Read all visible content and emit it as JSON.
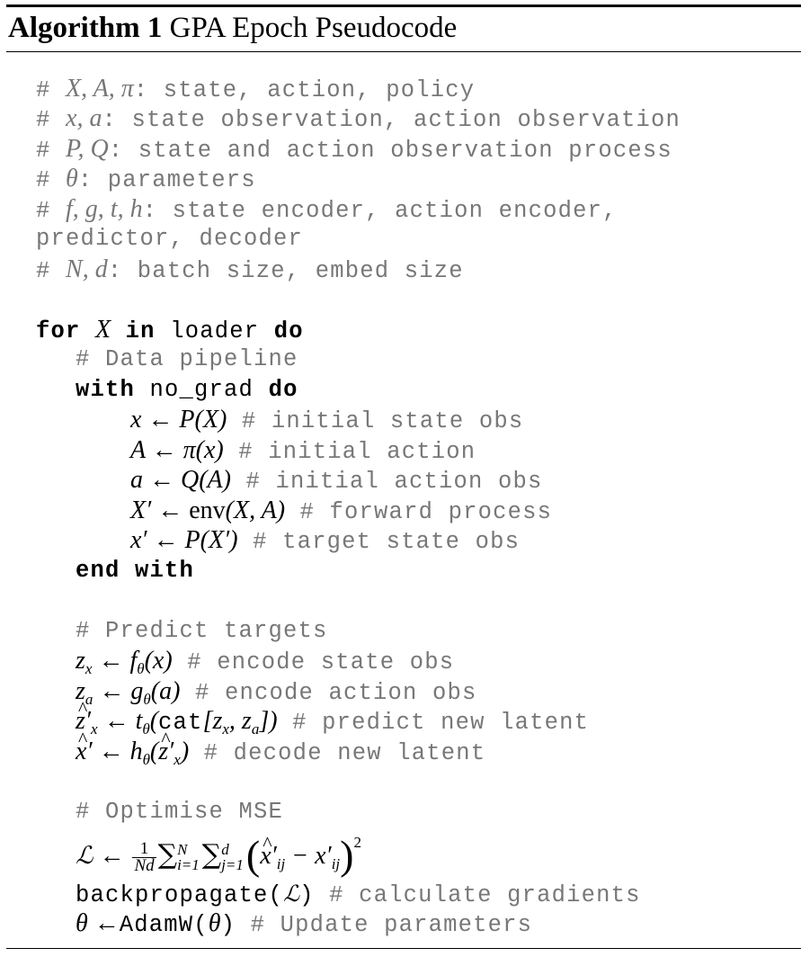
{
  "caption": {
    "label": "Algorithm 1",
    "title": "GPA Epoch Pseudocode"
  },
  "header_comments": {
    "c1": {
      "hash": "# ",
      "vars": "X, A, π",
      "text": ":  state, action, policy"
    },
    "c2": {
      "hash": "# ",
      "vars": "x, a",
      "text": ":  state observation, action observation"
    },
    "c3": {
      "hash": "# ",
      "vars": "P, Q",
      "text": ":  state and action observation process"
    },
    "c4": {
      "hash": "# ",
      "vars": "θ",
      "text": ":  parameters"
    },
    "c5": {
      "hash": "# ",
      "vars": "f, g, t, h",
      "text": ":  state encoder, action encoder,"
    },
    "c5b": {
      "text": "predictor, decoder"
    },
    "c6": {
      "hash": "# ",
      "vars": "N, d",
      "text": ":  batch size, embed size"
    }
  },
  "loop": {
    "for": "for",
    "var": "X",
    "in": "in",
    "iter": "loader",
    "do": "do"
  },
  "pipeline": {
    "comment": "# Data pipeline",
    "with": "with",
    "ctx": "no_grad",
    "do": "do",
    "end": "end with",
    "l1": {
      "math": "x ← P(X)",
      "comment": "# initial state obs"
    },
    "l2": {
      "math": "A ← π(x)",
      "comment": "# initial action"
    },
    "l3": {
      "math": "a ← Q(A)",
      "comment": "# initial action obs"
    },
    "l4": {
      "math_a": "X′ ← ",
      "fn": "env",
      "math_b": "(X, A)",
      "comment": "# forward process"
    },
    "l5": {
      "math": "x′ ← P(X′)",
      "comment": "# target state obs"
    }
  },
  "predict": {
    "comment": "# Predict targets",
    "l1": {
      "comment": "# encode state obs"
    },
    "l2": {
      "comment": "# encode action obs"
    },
    "l3": {
      "fn": "cat",
      "comment": "# predict new latent"
    },
    "l4": {
      "comment": "# decode new latent"
    }
  },
  "optimise": {
    "comment": "# Optimise MSE",
    "loss": {
      "lhs": "ℒ",
      "num": "1",
      "den": "Nd",
      "upper1": "N",
      "lower1": "i=1",
      "upper2": "d",
      "lower2": "j=1",
      "power": "2"
    },
    "backprop": {
      "fn": "backpropagate",
      "comment": "# calculate gradients"
    },
    "update": {
      "fn": "AdamW",
      "comment": "# Update parameters"
    }
  }
}
